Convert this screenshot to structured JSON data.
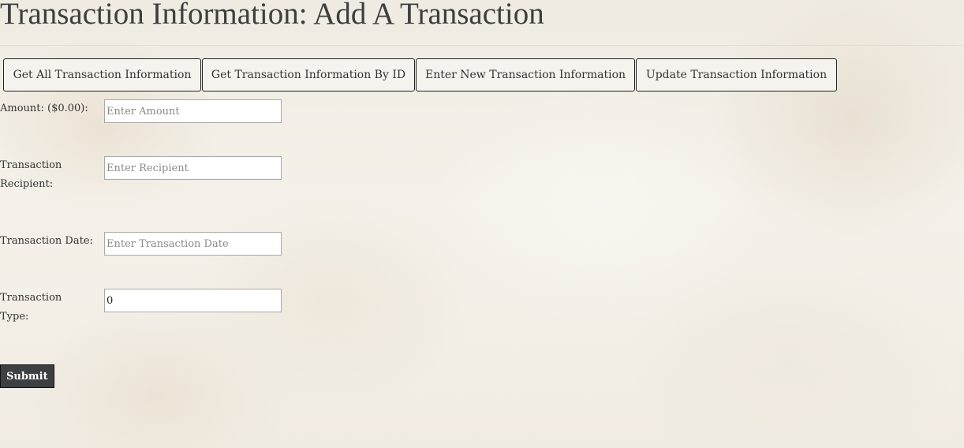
{
  "page": {
    "title": "Transaction Information: Add A Transaction"
  },
  "tabs": [
    {
      "label": "Get All Transaction Information"
    },
    {
      "label": "Get Transaction Information By ID"
    },
    {
      "label": "Enter New Transaction Information"
    },
    {
      "label": "Update Transaction Information"
    }
  ],
  "form": {
    "amount": {
      "label": "Amount: ($0.00):",
      "placeholder": "Enter Amount",
      "value": ""
    },
    "recipient": {
      "label_line1": "Transaction",
      "label_line2": "Recipient:",
      "placeholder": "Enter Recipient",
      "value": ""
    },
    "date": {
      "label": "Transaction Date:",
      "placeholder": "Enter Transaction Date",
      "value": ""
    },
    "type": {
      "label_line1": "Transaction",
      "label_line2": "Type:",
      "placeholder": "",
      "value": "0"
    },
    "submit_label": "Submit"
  }
}
